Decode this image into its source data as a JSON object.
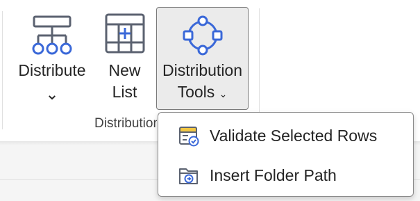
{
  "ribbon": {
    "buttons": {
      "distribute": {
        "label": "Distribute",
        "chevron": "⌄",
        "icon": "hierarchy-icon"
      },
      "new_list": {
        "label_line1": "New",
        "label_line2": "List",
        "icon": "table-add-icon"
      },
      "distribution_tools": {
        "label_line1": "Distribution",
        "label_line2": "Tools",
        "chevron": "⌄",
        "icon": "nodes-icon"
      }
    },
    "group_label": "Distribution"
  },
  "dropdown": {
    "items": [
      {
        "label": "Validate Selected Rows",
        "icon": "validate-rows-icon"
      },
      {
        "label": "Insert Folder Path",
        "icon": "folder-path-icon"
      }
    ]
  },
  "colors": {
    "accent": "#3a68d8",
    "icon_gray": "#5b6270",
    "highlight_yellow": "#f2c744"
  }
}
